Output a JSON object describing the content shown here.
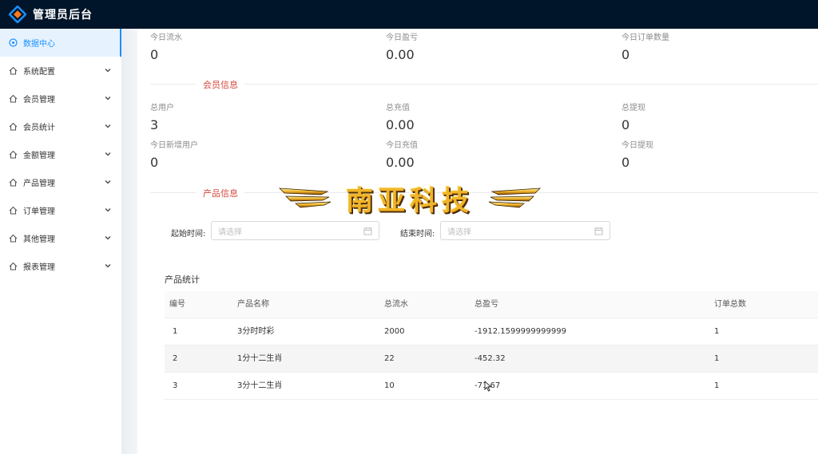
{
  "header": {
    "title": "管理员后台"
  },
  "sidebar": {
    "items": [
      {
        "label": "数据中心",
        "icon": "dashboard-icon",
        "active": true
      },
      {
        "label": "系统配置",
        "icon": "house-icon"
      },
      {
        "label": "会员管理",
        "icon": "house-icon"
      },
      {
        "label": "会员统计",
        "icon": "house-icon"
      },
      {
        "label": "金额管理",
        "icon": "house-icon"
      },
      {
        "label": "产品管理",
        "icon": "house-icon"
      },
      {
        "label": "订单管理",
        "icon": "house-icon"
      },
      {
        "label": "其他管理",
        "icon": "house-icon"
      },
      {
        "label": "报表管理",
        "icon": "house-icon"
      }
    ]
  },
  "today": {
    "flow": {
      "label": "今日流水",
      "value": "0"
    },
    "profit": {
      "label": "今日盈亏",
      "value": "0.00"
    },
    "orders": {
      "label": "今日订单数量",
      "value": "0"
    }
  },
  "member": {
    "section_title": "会员信息",
    "total_users": {
      "label": "总用户",
      "value": "3"
    },
    "total_recharge": {
      "label": "总充值",
      "value": "0.00"
    },
    "total_withdraw": {
      "label": "总提现",
      "value": "0"
    },
    "new_users": {
      "label": "今日新增用户",
      "value": "0"
    },
    "today_recharge": {
      "label": "今日充值",
      "value": "0.00"
    },
    "today_withdraw": {
      "label": "今日提现",
      "value": "0"
    }
  },
  "product": {
    "section_title": "产品信息",
    "banner_text": "南亚科技",
    "start_label": "起始时间:",
    "start_placeholder": "请选择",
    "end_label": "结束时间:",
    "end_placeholder": "请选择",
    "table_title": "产品统计",
    "columns": [
      "编号",
      "产品名称",
      "总流水",
      "总盈亏",
      "订单总数"
    ],
    "rows": [
      [
        "1",
        "3分时时彩",
        "2000",
        "-1912.1599999999999",
        "1"
      ],
      [
        "2",
        "1分十二生肖",
        "22",
        "-452.32",
        "1"
      ],
      [
        "3",
        "3分十二生肖",
        "10",
        "-71.67",
        "1"
      ]
    ]
  },
  "colors": {
    "topbar": "#001529",
    "accent": "#1890ff",
    "section_title": "#d4483d",
    "banner_gold": "#f0b429"
  }
}
